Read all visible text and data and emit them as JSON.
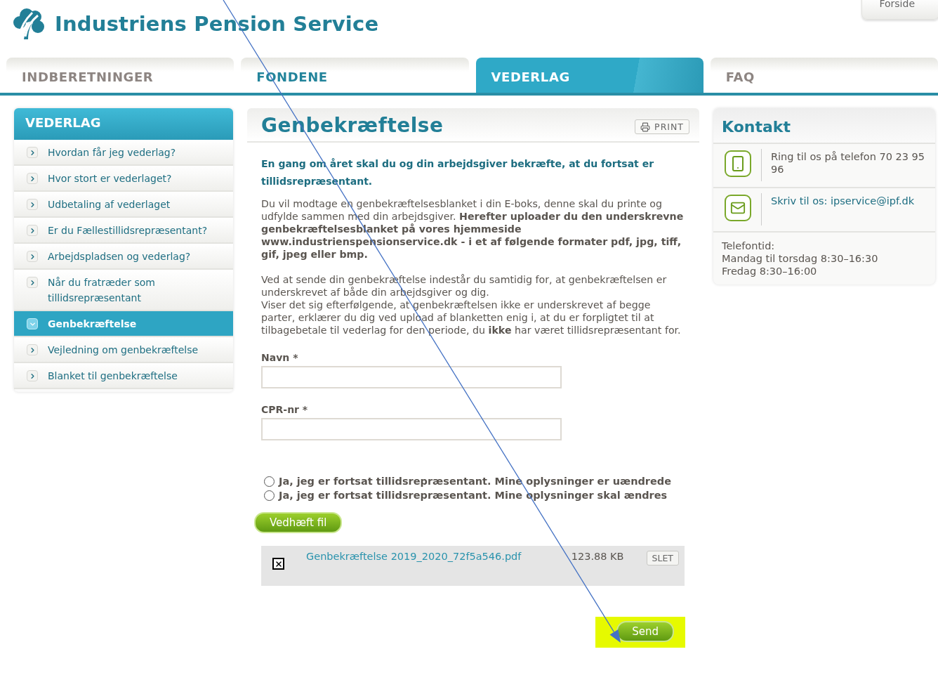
{
  "header": {
    "logo_text": "Industriens Pension Service",
    "top_link": "Forside"
  },
  "tabs": [
    {
      "label": "INDBERETNINGER",
      "selected": false,
      "color": "#8d8582"
    },
    {
      "label": "FONDENE",
      "selected": false,
      "color": "#23849b"
    },
    {
      "label": "VEDERLAG",
      "selected": true,
      "color": "#ffffff"
    },
    {
      "label": "FAQ",
      "selected": false,
      "color": "#8d8582"
    }
  ],
  "sidebar": {
    "title": "VEDERLAG",
    "items": [
      {
        "label": "Hvordan får jeg vederlag?",
        "selected": false
      },
      {
        "label": "Hvor stort er vederlaget?",
        "selected": false
      },
      {
        "label": "Udbetaling af vederlaget",
        "selected": false
      },
      {
        "label": "Er du Fællestillidsrepræsentant?",
        "selected": false
      },
      {
        "label": "Arbejdspladsen og vederlag?",
        "selected": false
      },
      {
        "label": "Når du fratræder som tillidsrepræsentant",
        "selected": false
      },
      {
        "label": "Genbekræftelse",
        "selected": true
      },
      {
        "label": "Vejledning om genbekræftelse",
        "selected": false
      },
      {
        "label": "Blanket til genbekræftelse",
        "selected": false
      }
    ]
  },
  "main": {
    "title": "Genbekræftelse",
    "print_button": "PRINT",
    "intro": "En gang om året skal du og din arbejdsgiver bekræfte, at du fortsat er tillidsrepræsentant.",
    "paragraphs": [
      {
        "text": "Du vil modtage en genbekræftelsesblanket i din E-boks, denne skal du printe og udfylde sammen med din arbejdsgiver. **Herefter uploader du den underskrevne genbekræftelsesblanket på vores hjemmeside www.industrienspensionservice.dk - i et af følgende formater pdf, jpg, tiff, gif, jpeg eller bmp.**"
      },
      {
        "text": "Ved at sende din genbekræftelse indestår du samtidig for, at genbekræftelsen er underskrevet af både din arbejdsgiver og dig."
      },
      {
        "text": "Viser det sig efterfølgende, at genbekræftelsen ikke er underskrevet af begge parter, erklærer du dig ved upload af blanketten enig i, at du er forpligtet til at tilbagebetale til vederlag for den periode, du **ikke** har været tillidsrepræsentant for."
      }
    ],
    "fields": [
      {
        "label": "Navn *"
      },
      {
        "label": "CPR-nr *"
      }
    ],
    "options": [
      {
        "label": "Ja, jeg er fortsat tillidsrepræsentant. Mine oplysninger er uændrede",
        "selected": false
      },
      {
        "label": "Ja, jeg er fortsat tillidsrepræsentant. Mine oplysninger skal ændres",
        "selected": false
      }
    ],
    "attach_button": "Vedhæft fil",
    "file": {
      "name": "Genbekræftelse 2019_2020_72f5a546.pdf",
      "size": "123.88 KB",
      "delete_button": "SLET"
    },
    "submit_button": "Send"
  },
  "contact": {
    "title": "Kontakt",
    "items": [
      {
        "kind": "phone",
        "text": "Ring til os på telefon 70 23 95 96"
      },
      {
        "kind": "email",
        "text": "Skriv til os: ipservice@ipf.dk"
      }
    ],
    "hours": [
      "Telefontid:",
      "Mandag til torsdag 8:30–16:30",
      "Fredag 8:30–16:00"
    ]
  }
}
